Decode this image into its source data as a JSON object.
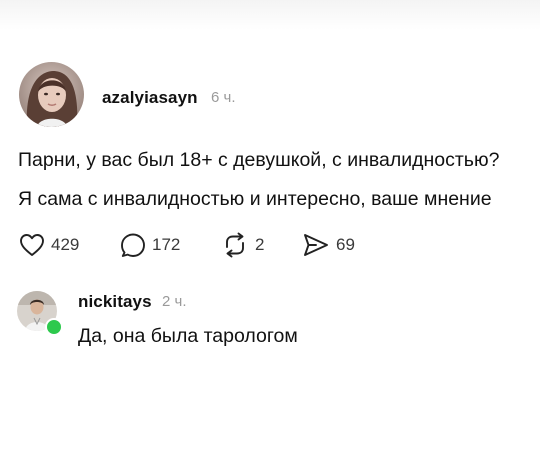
{
  "post": {
    "author": "azalyiasayn",
    "time": "6 ч.",
    "text_line1": "Парни, у вас был 18+ с девушкой, с инвалидностью?",
    "text_line2": "Я сама с инвалидностью и интересно, ваше мнение",
    "actions": {
      "likes": "429",
      "replies": "172",
      "reposts": "2",
      "shares": "69"
    }
  },
  "comment": {
    "author": "nickitays",
    "time": "2 ч.",
    "text": "Да, она была тарологом",
    "online": true
  },
  "icons": {
    "like": "heart-icon",
    "reply": "speech-bubble-icon",
    "repost": "repost-arrows-icon",
    "share": "send-icon"
  },
  "colors": {
    "online_indicator": "#2dc94d",
    "timestamp": "#9a9a9a"
  }
}
